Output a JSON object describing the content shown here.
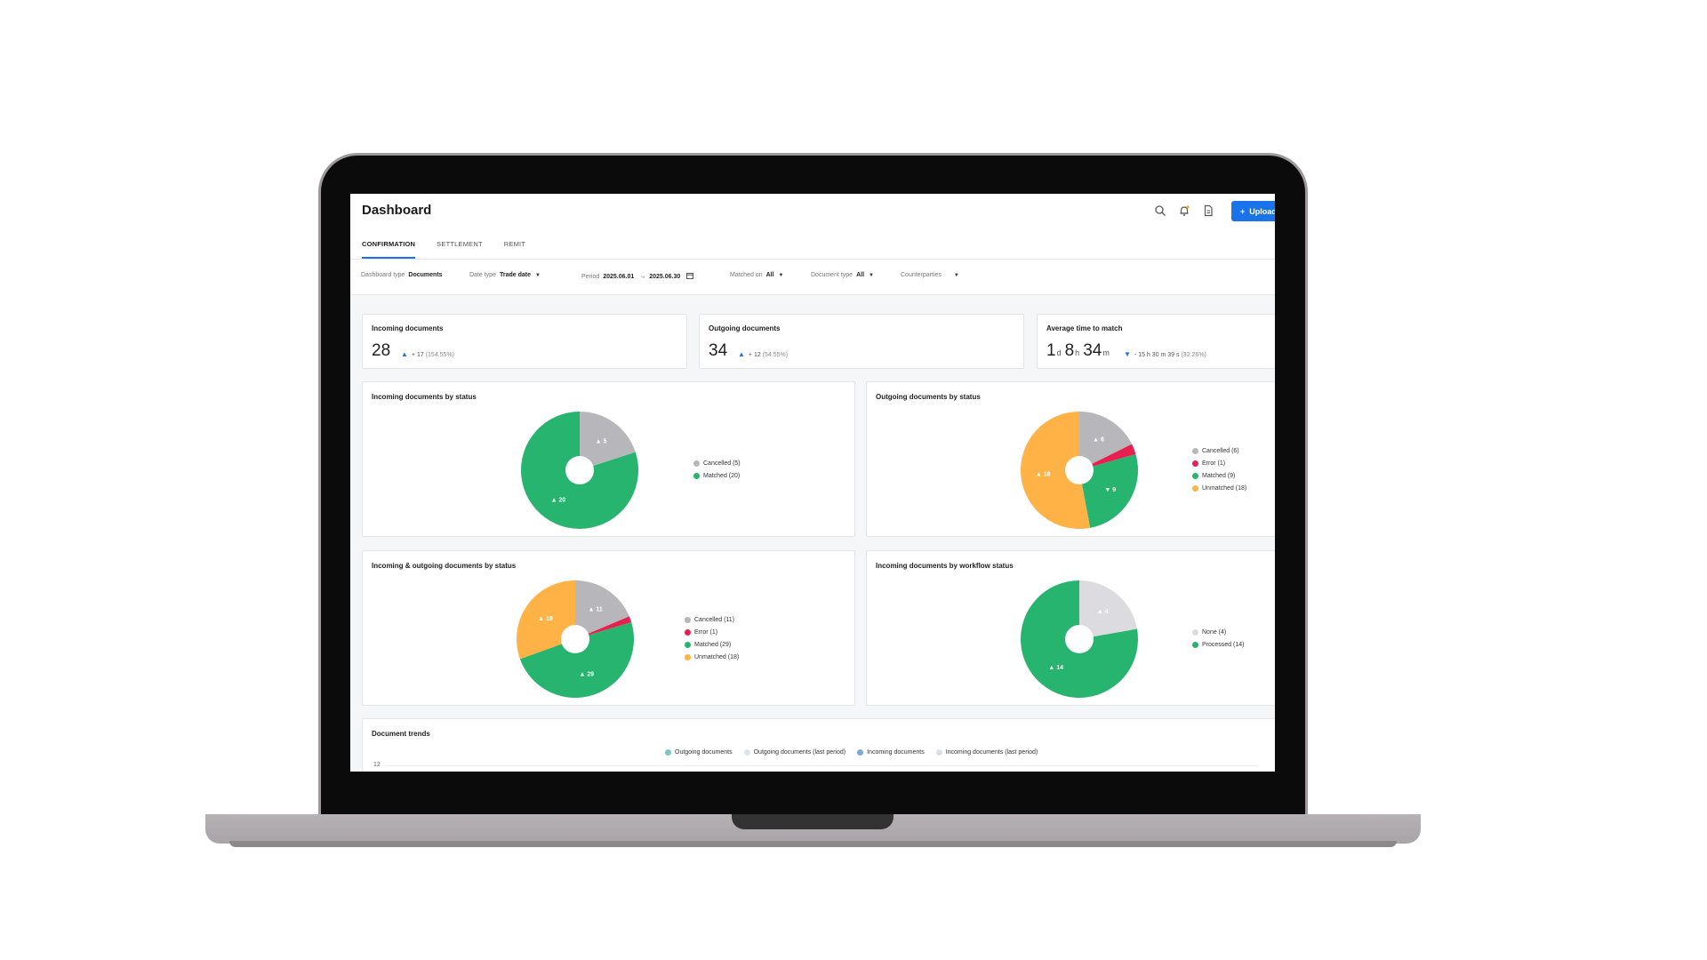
{
  "header": {
    "title": "Dashboard",
    "upload_label": "Upload",
    "upload_icon": "+"
  },
  "tabs": [
    "CONFIRMATION",
    "SETTLEMENT",
    "REMIT"
  ],
  "filters": {
    "dashboard_type": {
      "label": "Dashboard type",
      "value": "Documents"
    },
    "date_type": {
      "label": "Date type",
      "value": "Trade date"
    },
    "period": {
      "label": "Period",
      "start": "2025.06.01",
      "end": "2025.06.30"
    },
    "matched_on": {
      "label": "Matched on",
      "value": "All"
    },
    "document_type": {
      "label": "Document type",
      "value": "All"
    },
    "counterparties": {
      "label": "Counterparties"
    }
  },
  "kpis": {
    "incoming": {
      "title": "Incoming documents",
      "value": "28",
      "delta": "+ 17",
      "pct": "(154.55%)"
    },
    "outgoing": {
      "title": "Outgoing documents",
      "value": "34",
      "delta": "+ 12",
      "pct": "(54.55%)"
    },
    "avg_time": {
      "title": "Average time to match",
      "days": "1",
      "days_unit": "d",
      "hours": "8",
      "hours_unit": "h",
      "minutes": "34",
      "minutes_unit": "m",
      "delta": "- 15 h 30 m 39 s",
      "pct": "(32.26%)"
    }
  },
  "chart_data": [
    {
      "type": "pie",
      "title": "Incoming documents by status",
      "categories": [
        "Cancelled",
        "Matched"
      ],
      "values": [
        5,
        20
      ],
      "legend": [
        "Cancelled (5)",
        "Matched (20)"
      ],
      "colors": [
        "#b7b7bb",
        "#27b46e"
      ],
      "slice_labels": [
        "▲ 5",
        "▲ 20"
      ],
      "legend_position": "right"
    },
    {
      "type": "pie",
      "title": "Outgoing documents by status",
      "categories": [
        "Cancelled",
        "Error",
        "Matched",
        "Unmatched"
      ],
      "values": [
        6,
        1,
        9,
        18
      ],
      "legend": [
        "Cancelled (6)",
        "Error (1)",
        "Matched (9)",
        "Unmatched (18)"
      ],
      "colors": [
        "#b7b7bb",
        "#e8204f",
        "#27b46e",
        "#ffb347"
      ],
      "slice_labels": [
        "▲ 6",
        "",
        "▼ 9",
        "▲ 18"
      ],
      "legend_position": "right"
    },
    {
      "type": "pie",
      "title": "Incoming & outgoing documents by status",
      "categories": [
        "Cancelled",
        "Error",
        "Matched",
        "Unmatched"
      ],
      "values": [
        11,
        1,
        29,
        18
      ],
      "legend": [
        "Cancelled (11)",
        "Error (1)",
        "Matched (29)",
        "Unmatched (18)"
      ],
      "colors": [
        "#b7b7bb",
        "#e8204f",
        "#27b46e",
        "#ffb347"
      ],
      "slice_labels": [
        "▲ 11",
        "",
        "▲ 29",
        "▲ 18"
      ],
      "legend_position": "right"
    },
    {
      "type": "pie",
      "title": "Incoming documents by workflow status",
      "categories": [
        "None",
        "Processed"
      ],
      "values": [
        4,
        14
      ],
      "legend": [
        "None (4)",
        "Processed (14)"
      ],
      "colors": [
        "#dcdce0",
        "#27b46e"
      ],
      "slice_labels": [
        "▲ 4",
        "▲ 14"
      ],
      "legend_position": "right"
    },
    {
      "type": "line",
      "title": "Document trends",
      "series_names": [
        "Outgoing documents",
        "Outgoing documents (last period)",
        "Incoming documents",
        "Incoming documents (last period)"
      ],
      "series_colors": [
        "#7fc3c7",
        "#d6e6ec",
        "#7aa9d8",
        "#d6e0ea"
      ],
      "y_ticks": [
        "12"
      ]
    }
  ]
}
